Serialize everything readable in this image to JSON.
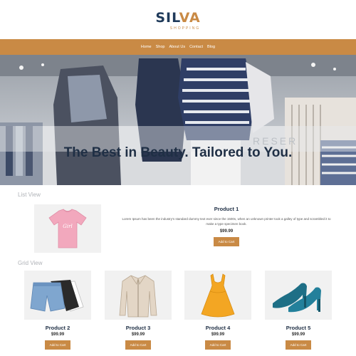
{
  "header": {
    "logo_main": "SIL",
    "logo_accent": "VA",
    "logo_sub": "SHOPPING"
  },
  "nav": {
    "items": [
      {
        "label": "Home"
      },
      {
        "label": "Shop"
      },
      {
        "label": "About Us"
      },
      {
        "label": "Contact"
      },
      {
        "label": "Blog"
      }
    ]
  },
  "hero": {
    "title": "The Best in Beauty. Tailored to You."
  },
  "list_view": {
    "label": "List View",
    "product": {
      "title": "Product 1",
      "description": "Lorem Ipsum has been the industry's standard dummy text ever since the 1500s, when an unknown printer took a galley of type and scrambled it to make a type specimen book.",
      "price": "$99.99",
      "button": "Add to Cart",
      "icon": "pink-tshirt-icon"
    }
  },
  "grid_view": {
    "label": "Grid View",
    "products": [
      {
        "title": "Product 2",
        "price": "$99.99",
        "button": "Add to Cart",
        "icon": "denim-shorts-icon"
      },
      {
        "title": "Product 3",
        "price": "$99.99",
        "button": "Add to Cart",
        "icon": "beige-jacket-icon"
      },
      {
        "title": "Product 4",
        "price": "$99.99",
        "button": "Add to Cart",
        "icon": "yellow-dress-icon"
      },
      {
        "title": "Product 5",
        "price": "$99.99",
        "button": "Add to Cart",
        "icon": "teal-heels-icon"
      }
    ]
  },
  "colors": {
    "accent": "#c98a45",
    "navy": "#1f3a5a"
  }
}
